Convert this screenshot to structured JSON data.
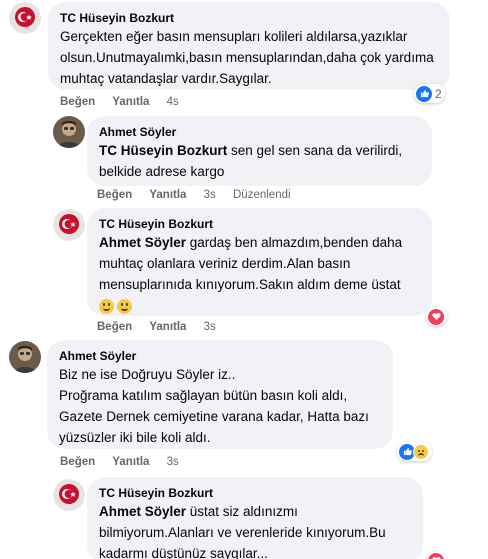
{
  "comments": [
    {
      "author": "TC Hüseyin Bozkurt",
      "text": "Gerçekten eğer basın mensupları kolileri aldılarsa,yazıklar olsun.Unutmayalımki,basın mensuplarından,daha çok yardıma muhtaç vatandaşlar vardır.Saygılar.",
      "like_label": "Beğen",
      "reply_label": "Yanıtla",
      "time": "4s",
      "reaction_count": "2",
      "reaction_types": [
        "like-icon"
      ]
    },
    {
      "author": "Ahmet Söyler",
      "mention": "TC Hüseyin Bozkurt",
      "text": " sen gel sen sana da verilirdi, belkide adrese kargo",
      "like_label": "Beğen",
      "reply_label": "Yanıtla",
      "time": "3s",
      "edited_label": "Düzenlendi"
    },
    {
      "author": "TC Hüseyin Bozkurt",
      "mention": "Ahmet Söyler",
      "text": " gardaş ben almazdım,benden daha muhtaç olanlara veriniz derdim.Alan basın mensuplarınıda kınıyorum.Sakın aldım deme üstat",
      "emojis": [
        "grinning-emoji",
        "grinning-emoji"
      ],
      "like_label": "Beğen",
      "reply_label": "Yanıtla",
      "time": "3s",
      "reaction_types": [
        "love-icon"
      ]
    },
    {
      "author": "Ahmet Söyler",
      "lines": [
        "Biz ne ise Doğruyu Söyler iz..",
        "Proğrama katılım sağlayan bütün basın koli aldı,",
        "Gazete Dernek cemiyetine varana kadar, Hatta bazı",
        "yüzsüzler iki bile koli aldı."
      ],
      "like_label": "Beğen",
      "reply_label": "Yanıtla",
      "time": "3s",
      "reaction_types": [
        "like-icon",
        "sad-icon"
      ]
    },
    {
      "author": "TC Hüseyin Bozkurt",
      "mention": "Ahmet Söyler",
      "text": " üstat siz aldınızmı bilmiyorum.Alanları ve verenleride kınıyorum.Bu kadarmı düştünüz saygılar...",
      "reaction_types": [
        "love-icon"
      ]
    }
  ],
  "colors": {
    "bubble": "#f0f2f5",
    "meta": "#65676b",
    "like": "#1877f2",
    "love": "#f33e58"
  }
}
